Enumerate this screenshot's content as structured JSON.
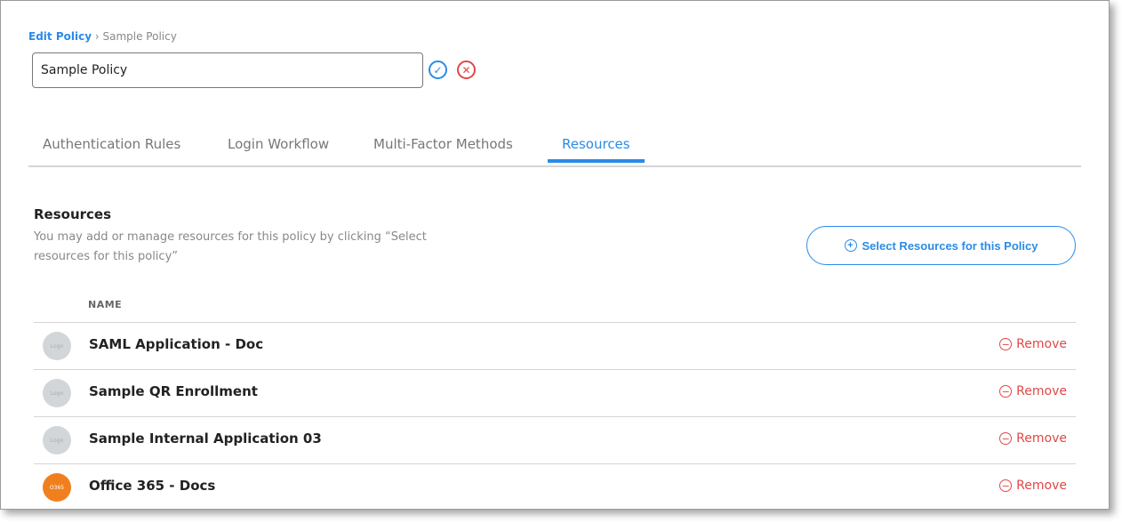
{
  "breadcrumb": {
    "parent": "Edit Policy",
    "separator": "›",
    "current": "Sample Policy"
  },
  "policy_name": {
    "value": "Sample Policy"
  },
  "tabs": [
    {
      "label": "Authentication Rules"
    },
    {
      "label": "Login Workflow"
    },
    {
      "label": "Multi-Factor Methods"
    },
    {
      "label": "Resources",
      "active": true
    }
  ],
  "section": {
    "title": "Resources",
    "description": "You may add or manage resources for this policy by clicking “Select resources for this policy”",
    "select_button": "Select Resources for this Policy"
  },
  "table": {
    "column": "NAME",
    "remove_label": "Remove",
    "rows": [
      {
        "name": "SAML Application - Doc",
        "logo": "placeholder-logo"
      },
      {
        "name": "Sample QR Enrollment",
        "logo": "placeholder-logo"
      },
      {
        "name": "Sample Internal Application 03",
        "logo": "placeholder-logo"
      },
      {
        "name": "Office 365 - Docs",
        "logo": "office-365-logo"
      }
    ]
  },
  "colors": {
    "accent": "#2a8be8",
    "danger": "#e04848",
    "office": "#f0801e"
  }
}
